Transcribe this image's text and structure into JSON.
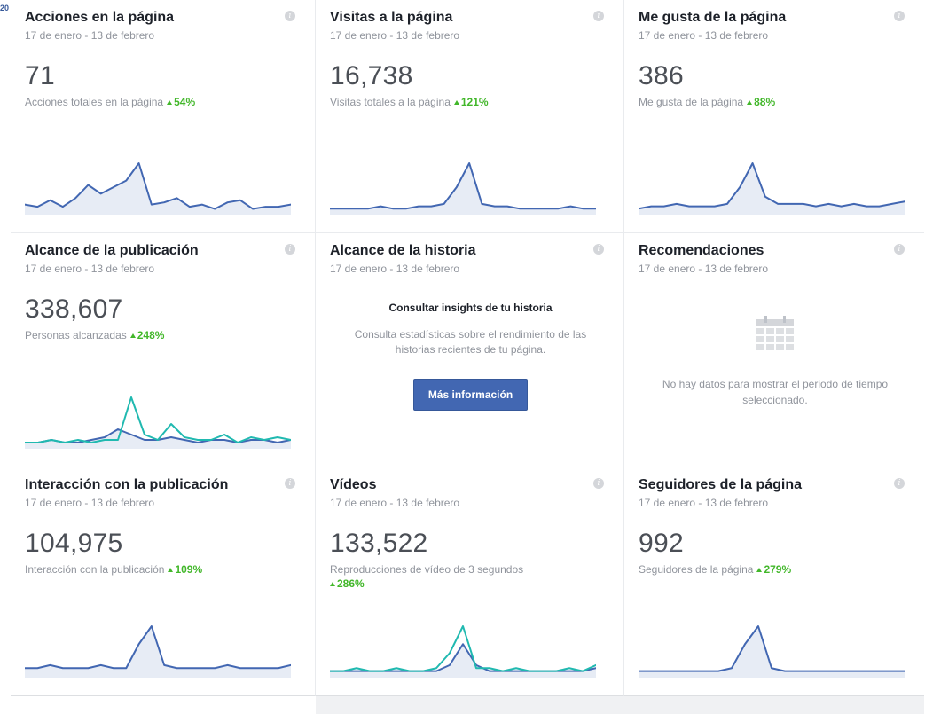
{
  "corner_label": "20",
  "cards": [
    {
      "title": "Acciones en la página",
      "range": "17 de enero - 13 de febrero",
      "value": "71",
      "subtitle": "Acciones totales en la página",
      "delta": "54%",
      "chart_data": {
        "type": "line",
        "series": [
          {
            "values": [
              3,
              2,
              5,
              2,
              6,
              12,
              8,
              11,
              14,
              22,
              3,
              4,
              6,
              2,
              3,
              1,
              4,
              5,
              1,
              2,
              2,
              3
            ],
            "color": "#4267b2"
          }
        ],
        "area": true
      }
    },
    {
      "title": "Visitas a la página",
      "range": "17 de enero - 13 de febrero",
      "value": "16,738",
      "subtitle": "Visitas totales a la página",
      "delta": "121%",
      "chart_data": {
        "type": "line",
        "series": [
          {
            "values": [
              1,
              1,
              1,
              1,
              2,
              1,
              1,
              2,
              2,
              3,
              10,
              20,
              3,
              2,
              2,
              1,
              1,
              1,
              1,
              2,
              1,
              1
            ],
            "color": "#4267b2"
          }
        ],
        "area": true
      }
    },
    {
      "title": "Me gusta de la página",
      "range": "17 de enero - 13 de febrero",
      "value": "386",
      "subtitle": "Me gusta de la página",
      "delta": "88%",
      "chart_data": {
        "type": "line",
        "series": [
          {
            "values": [
              1,
              2,
              2,
              3,
              2,
              2,
              2,
              3,
              10,
              20,
              6,
              3,
              3,
              3,
              2,
              3,
              2,
              3,
              2,
              2,
              3,
              4
            ],
            "color": "#4267b2"
          }
        ],
        "area": true
      }
    },
    {
      "title": "Alcance de la publicación",
      "range": "17 de enero - 13 de febrero",
      "value": "338,607",
      "subtitle": "Personas alcanzadas",
      "delta": "248%",
      "chart_data": {
        "type": "line",
        "series": [
          {
            "values": [
              1,
              1,
              2,
              1,
              1,
              2,
              3,
              6,
              4,
              2,
              2,
              3,
              2,
              1,
              2,
              2,
              1,
              2,
              2,
              1,
              2
            ],
            "color": "#4267b2"
          },
          {
            "values": [
              1,
              1,
              2,
              1,
              2,
              1,
              2,
              2,
              18,
              4,
              2,
              8,
              3,
              2,
              2,
              4,
              1,
              3,
              2,
              3,
              2
            ],
            "color": "#20b9b0"
          }
        ],
        "area": true
      }
    },
    {
      "title": "Alcance de la historia",
      "range": "17 de enero - 13 de febrero",
      "story_heading": "Consultar insights de tu historia",
      "story_text": "Consulta estadísticas sobre el rendimiento de las historias recientes de tu página.",
      "button_label": "Más información"
    },
    {
      "title": "Recomendaciones",
      "range": "17 de enero - 13 de febrero",
      "empty_text": "No hay datos para mostrar el periodo de tiempo seleccionado."
    },
    {
      "title": "Interacción con la publicación",
      "range": "17 de enero - 13 de febrero",
      "value": "104,975",
      "subtitle": "Interacción con la publicación",
      "delta": "109%",
      "chart_data": {
        "type": "line",
        "series": [
          {
            "values": [
              2,
              2,
              3,
              2,
              2,
              2,
              3,
              2,
              2,
              10,
              16,
              3,
              2,
              2,
              2,
              2,
              3,
              2,
              2,
              2,
              2,
              3
            ],
            "color": "#4267b2"
          }
        ],
        "area": true
      }
    },
    {
      "title": "Vídeos",
      "range": "17 de enero - 13 de febrero",
      "value": "133,522",
      "subtitle": "Reproducciones de vídeo de 3 segundos",
      "delta": "286%",
      "chart_data": {
        "type": "line",
        "series": [
          {
            "values": [
              1,
              1,
              1,
              1,
              1,
              1,
              1,
              1,
              1,
              3,
              10,
              3,
              1,
              1,
              1,
              1,
              1,
              1,
              1,
              1,
              2
            ],
            "color": "#4267b2"
          },
          {
            "values": [
              1,
              1,
              2,
              1,
              1,
              2,
              1,
              1,
              2,
              7,
              16,
              2,
              2,
              1,
              2,
              1,
              1,
              1,
              2,
              1,
              3
            ],
            "color": "#20b9b0"
          }
        ],
        "area": true
      }
    },
    {
      "title": "Seguidores de la página",
      "range": "17 de enero - 13 de febrero",
      "value": "992",
      "subtitle": "Seguidores de la página",
      "delta": "279%",
      "chart_data": {
        "type": "line",
        "series": [
          {
            "values": [
              1,
              1,
              1,
              1,
              1,
              1,
              1,
              2,
              10,
              16,
              2,
              1,
              1,
              1,
              1,
              1,
              1,
              1,
              1,
              1,
              1
            ],
            "color": "#4267b2"
          }
        ],
        "area": true
      }
    }
  ]
}
